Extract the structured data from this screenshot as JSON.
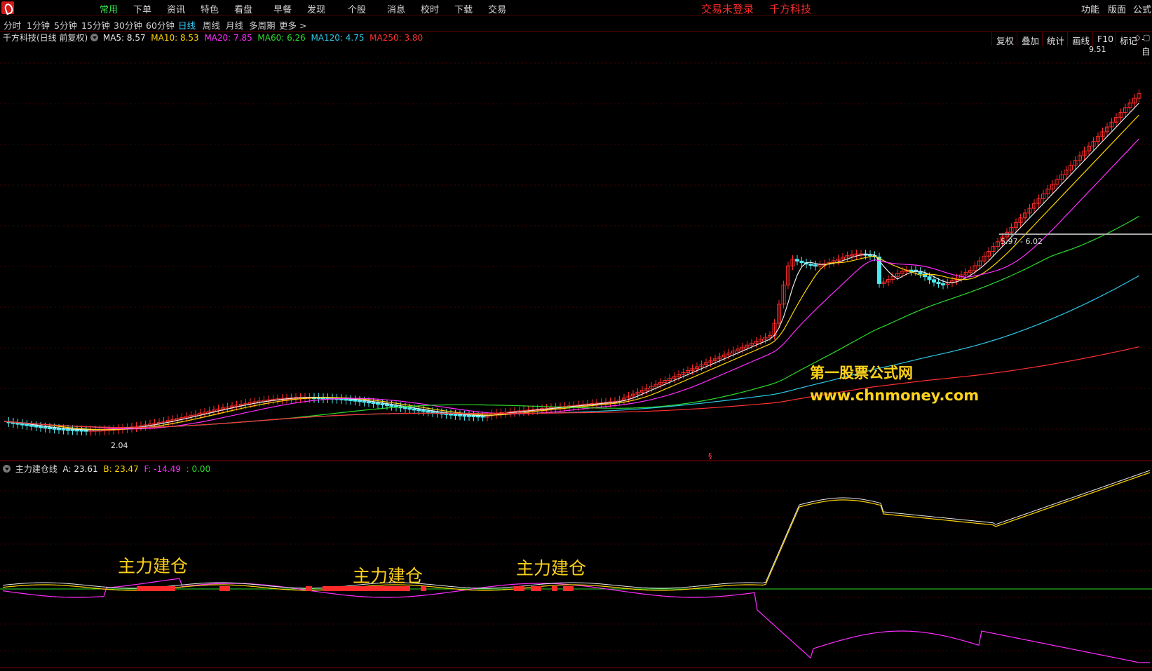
{
  "menu": {
    "items": [
      "常用",
      "下单",
      "资讯",
      "特色",
      "看盘",
      "早餐",
      "发现",
      "个股",
      "消息",
      "校时",
      "下载",
      "交易"
    ],
    "login_status": "交易未登录",
    "stock_name": "千方科技",
    "right": [
      "功能",
      "版面",
      "公式"
    ]
  },
  "periods": [
    "分时",
    "1分钟",
    "5分钟",
    "15分钟",
    "30分钟",
    "60分钟",
    "日线",
    "周线",
    "月线",
    "多周期",
    "更多 >"
  ],
  "toolbar": [
    "复权",
    "叠加",
    "统计",
    "画线",
    "F10",
    "标记",
    "-自"
  ],
  "main_legend": {
    "title": "千方科技(日线 前复权)",
    "ma": [
      {
        "label": "MA5: 8.57",
        "color": "#e8e8e8"
      },
      {
        "label": "MA10: 8.53",
        "color": "#ffd400"
      },
      {
        "label": "MA20: 7.85",
        "color": "#ff2cff"
      },
      {
        "label": "MA60: 6.26",
        "color": "#2cdc2c"
      },
      {
        "label": "MA120: 4.75",
        "color": "#2cc8e6"
      },
      {
        "label": "MA250: 3.80",
        "color": "#ff3030"
      }
    ]
  },
  "price_labels": {
    "high": "9.51",
    "low": "2.04",
    "range": "5.97 - 6.02"
  },
  "indicator_legend": {
    "title": "主力建仓线",
    "values": [
      {
        "label": "A: 23.61",
        "color": "#e8e8e8"
      },
      {
        "label": "B: 23.47",
        "color": "#ffd400"
      },
      {
        "label": "F: -14.49",
        "color": "#ff2cff"
      },
      {
        "label": ": 0.00",
        "color": "#2cdc2c"
      }
    ]
  },
  "annotations": [
    "主力建仓",
    "主力建仓",
    "主力建仓"
  ],
  "watermark": {
    "name": "第一股票公式网",
    "url": "www.chnmoney.com"
  },
  "colors": {
    "up": "#ff2a2a",
    "down": "#4ce8f0",
    "grid": "#5a0000",
    "accent": "#34e04a"
  }
}
